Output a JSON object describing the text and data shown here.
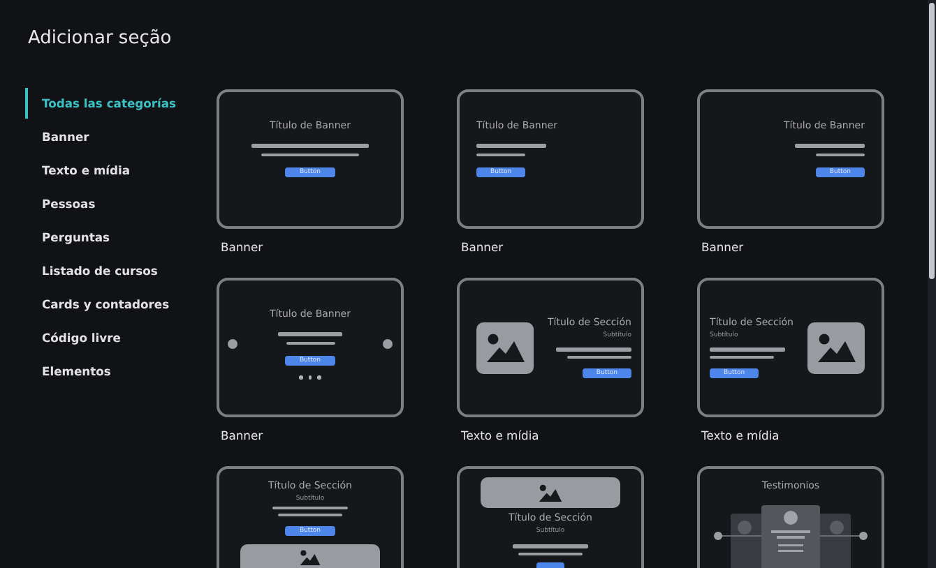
{
  "title": "Adicionar seção",
  "categories": [
    {
      "label": "Todas las categorías",
      "selected": true
    },
    {
      "label": "Banner",
      "selected": false
    },
    {
      "label": "Texto e mídia",
      "selected": false
    },
    {
      "label": "Pessoas",
      "selected": false
    },
    {
      "label": "Perguntas",
      "selected": false
    },
    {
      "label": "Listado de cursos",
      "selected": false
    },
    {
      "label": "Cards y contadores",
      "selected": false
    },
    {
      "label": "Código livre",
      "selected": false
    },
    {
      "label": "Elementos",
      "selected": false
    }
  ],
  "sections": [
    {
      "kind": "banner-center",
      "preview": {
        "title": "Título de Banner",
        "button": "Button"
      },
      "label": "Banner"
    },
    {
      "kind": "banner-left",
      "preview": {
        "title": "Título de Banner",
        "button": "Button"
      },
      "label": "Banner"
    },
    {
      "kind": "banner-right",
      "preview": {
        "title": "Título de Banner",
        "button": "Button"
      },
      "label": "Banner"
    },
    {
      "kind": "carousel",
      "preview": {
        "title": "Título de Banner",
        "button": "Button"
      },
      "label": "Banner"
    },
    {
      "kind": "media-image-left",
      "preview": {
        "title": "Título de Sección",
        "subtitle": "Subtítulo",
        "button": "Button"
      },
      "label": "Texto e mídia"
    },
    {
      "kind": "media-image-right",
      "preview": {
        "title": "Título de Sección",
        "subtitle": "Subtítulo",
        "button": "Button"
      },
      "label": "Texto e mídia"
    },
    {
      "kind": "image-below",
      "preview": {
        "title": "Título de Sección",
        "subtitle": "Subtítulo",
        "button": "Button"
      }
    },
    {
      "kind": "image-above",
      "preview": {
        "title": "Título de Sección",
        "subtitle": "Subtítulo"
      }
    },
    {
      "kind": "testimonials",
      "preview": {
        "title": "Testimonios"
      }
    }
  ]
}
